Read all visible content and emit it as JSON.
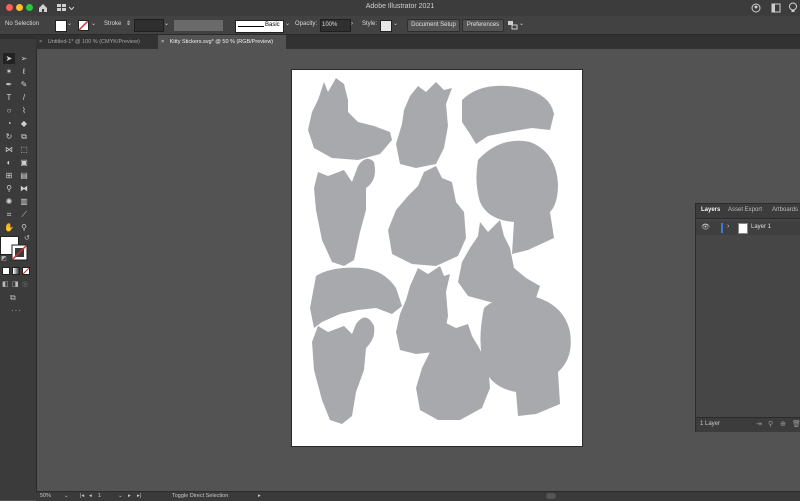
{
  "app": {
    "title": "Adobe Illustrator 2021"
  },
  "controlbar": {
    "selection_label": "No Selection",
    "stroke_label": "Stroke",
    "brush_label": "Basic",
    "opacity_label": "Opacity:",
    "opacity_value": "100%",
    "style_label": "Style:",
    "document_setup": "Document Setup",
    "preferences": "Preferences"
  },
  "tabs": [
    {
      "close": "×",
      "label": "Untitled-1* @ 100 % (CMYK/Preview)"
    },
    {
      "close": "×",
      "label": "Kitty Stickers.svg* @ 50 % (RGB/Preview)"
    }
  ],
  "layers_panel": {
    "tabs": [
      "Layers",
      "Asset Export",
      "Artboards"
    ],
    "layer_name": "Layer 1",
    "footer_count": "1 Layer"
  },
  "statusbar": {
    "zoom": "50%",
    "artboard_number": "1",
    "tool_hint": "Toggle Direct Selection"
  },
  "colors": {
    "silhouette": "#a8a9ad",
    "accent": "#3d7ad6"
  }
}
